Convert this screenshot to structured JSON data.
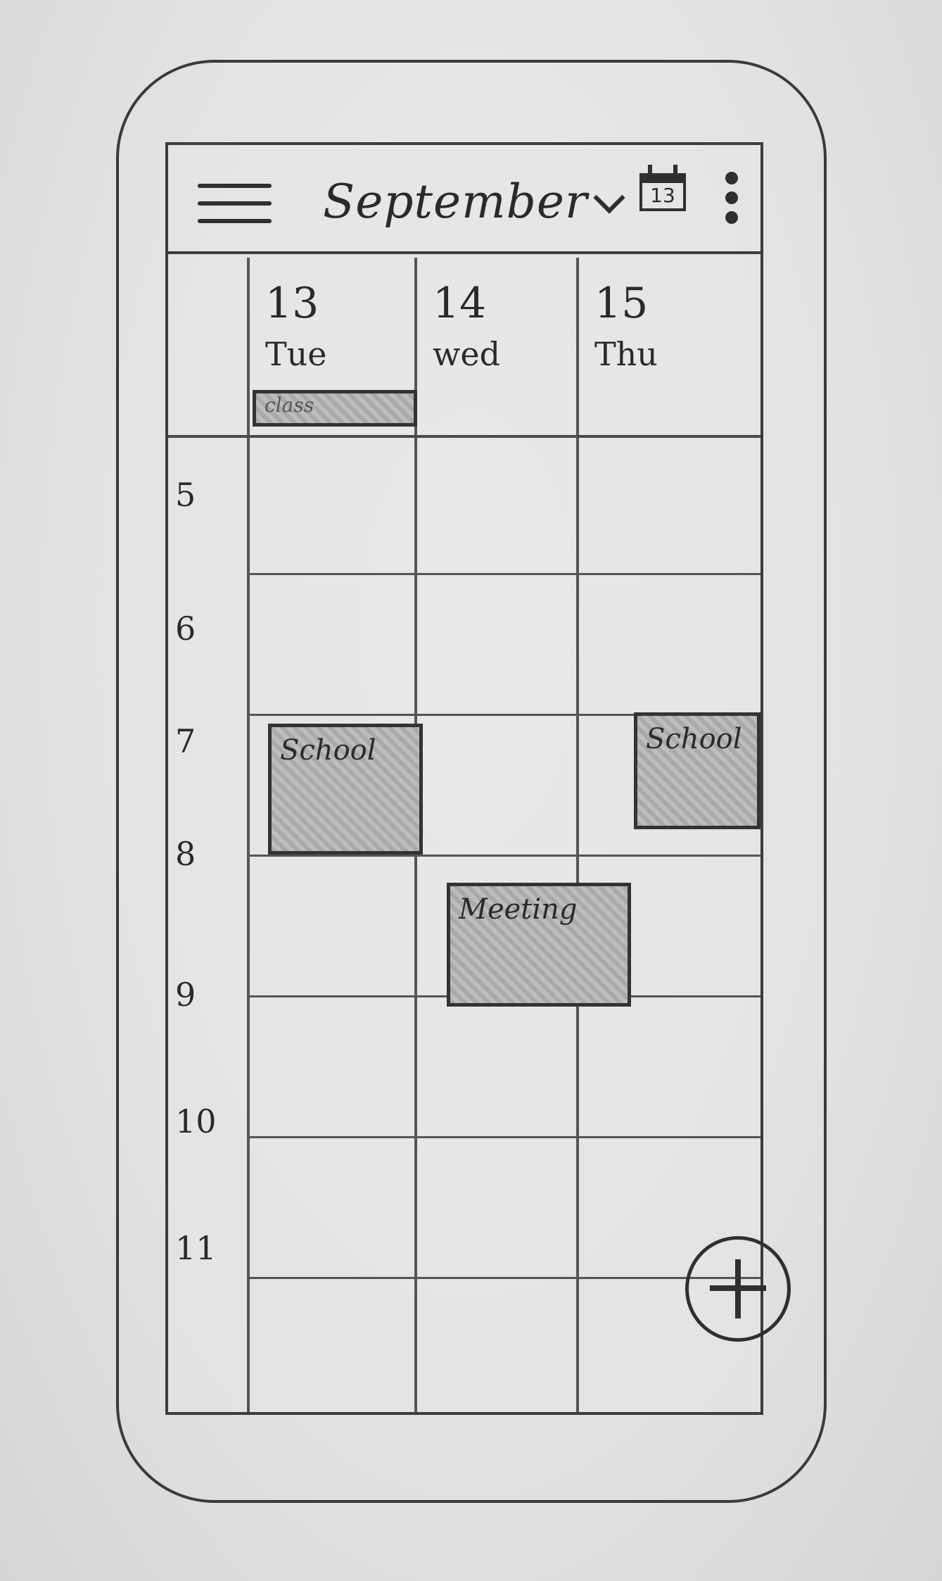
{
  "app_bar": {
    "month": "September",
    "today_date": "13"
  },
  "days": [
    {
      "number": "13",
      "name": "Tue"
    },
    {
      "number": "14",
      "name": "wed"
    },
    {
      "number": "15",
      "name": "Thu"
    }
  ],
  "hours": [
    "5",
    "6",
    "7",
    "8",
    "9",
    "10",
    "11"
  ],
  "events": {
    "allday_tue": "class",
    "school_tue": "School",
    "school_thu": "School",
    "meeting_wed": "Meeting"
  },
  "icons": {
    "menu": "hamburger-menu-icon",
    "chevron": "chevron-down-icon",
    "today": "calendar-today-icon",
    "more": "more-vert-icon",
    "fab": "add-icon"
  }
}
